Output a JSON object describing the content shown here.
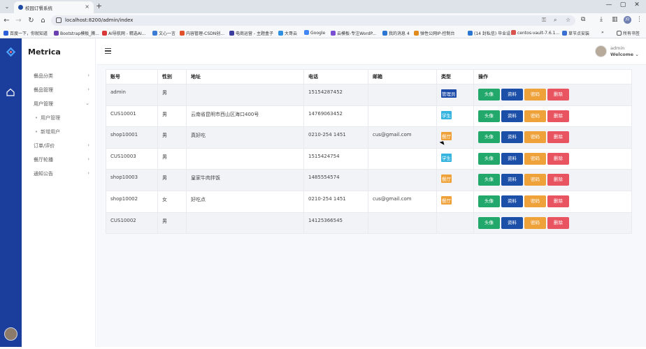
{
  "browser": {
    "tab_title": "校园订餐系统",
    "url": "localhost:8200/admin/index",
    "bookmarks": [
      {
        "label": "百度一下，你就知道",
        "color": "#2b5fd9"
      },
      {
        "label": "Bootstrap模板_腾...",
        "color": "#6a3fb0"
      },
      {
        "label": "AI导航网 - 精选AI...",
        "color": "#d93838"
      },
      {
        "label": "文心一言",
        "color": "#3a7bd5"
      },
      {
        "label": "内容管理-CSDN创...",
        "color": "#e0502b"
      },
      {
        "label": "电商运营 - 主题盒子",
        "color": "#3d3d9e"
      },
      {
        "label": "大哥云",
        "color": "#2f8fe0"
      },
      {
        "label": "Google",
        "color": "#4285f4"
      },
      {
        "label": "云模板-专注WordP...",
        "color": "#7b4fd1"
      },
      {
        "label": "我的消息 4",
        "color": "#2a76d2"
      },
      {
        "label": "弹性公网IP-控制台",
        "color": "#e08a1e"
      },
      {
        "label": "(14 封私信) 毕业设...",
        "color": "#2a76d2"
      },
      {
        "label": "centos-vault-7.6.1...",
        "color": "#d9534f"
      },
      {
        "label": "草节点安装",
        "color": "#3a6fd1"
      }
    ],
    "all_bookmarks": "所有书签",
    "profile_initials": "JQ"
  },
  "app": {
    "brand": "Metrica",
    "menu": [
      {
        "label": "餐品分类",
        "expanded": false
      },
      {
        "label": "餐品管理",
        "expanded": false
      },
      {
        "label": "用户管理",
        "expanded": true
      },
      {
        "label": "订单/评价",
        "expanded": false
      },
      {
        "label": "餐厅轮播",
        "expanded": false
      },
      {
        "label": "通知公告",
        "expanded": false
      }
    ],
    "submenu": [
      "用户管理",
      "新增用户"
    ],
    "user": {
      "name": "admin",
      "welcome": "Welcome"
    }
  },
  "table": {
    "headers": [
      "账号",
      "性别",
      "地址",
      "电话",
      "邮箱",
      "类型",
      "操作"
    ],
    "buttons": {
      "avatar": "头像",
      "profile": "资料",
      "password": "密码",
      "delete": "删除"
    },
    "rows": [
      {
        "account": "admin",
        "gender": "男",
        "address": "",
        "phone": "15154287452",
        "email": "",
        "type": "管理员",
        "type_color": "#1c4aa8"
      },
      {
        "account": "CUS10001",
        "gender": "男",
        "address": "云南省昆明市西山区海口400号",
        "phone": "14769063452",
        "email": "",
        "type": "学生",
        "type_color": "#36b4e0"
      },
      {
        "account": "shop10001",
        "gender": "男",
        "address": "真好吃",
        "phone": "0210-254 1451",
        "email": "cus@gmail.com",
        "type": "餐厅",
        "type_color": "#f0a23a"
      },
      {
        "account": "CUS10003",
        "gender": "男",
        "address": "",
        "phone": "1515424754",
        "email": "",
        "type": "学生",
        "type_color": "#36b4e0"
      },
      {
        "account": "shop10003",
        "gender": "男",
        "address": "皇家牛肉拌饭",
        "phone": "1485554574",
        "email": "",
        "type": "餐厅",
        "type_color": "#f0a23a"
      },
      {
        "account": "shop10002",
        "gender": "女",
        "address": "好吃点",
        "phone": "0210-254 1451",
        "email": "cus@gmail.com",
        "type": "餐厅",
        "type_color": "#f0a23a"
      },
      {
        "account": "CUS10002",
        "gender": "男",
        "address": "",
        "phone": "14125366545",
        "email": "",
        "type": "",
        "type_color": ""
      }
    ]
  },
  "colors": {
    "rail": "#1b3d9c",
    "btn_avatar": "#22a86b",
    "btn_profile": "#1c4fa8",
    "btn_password": "#f0a23a",
    "btn_delete": "#e95461"
  }
}
